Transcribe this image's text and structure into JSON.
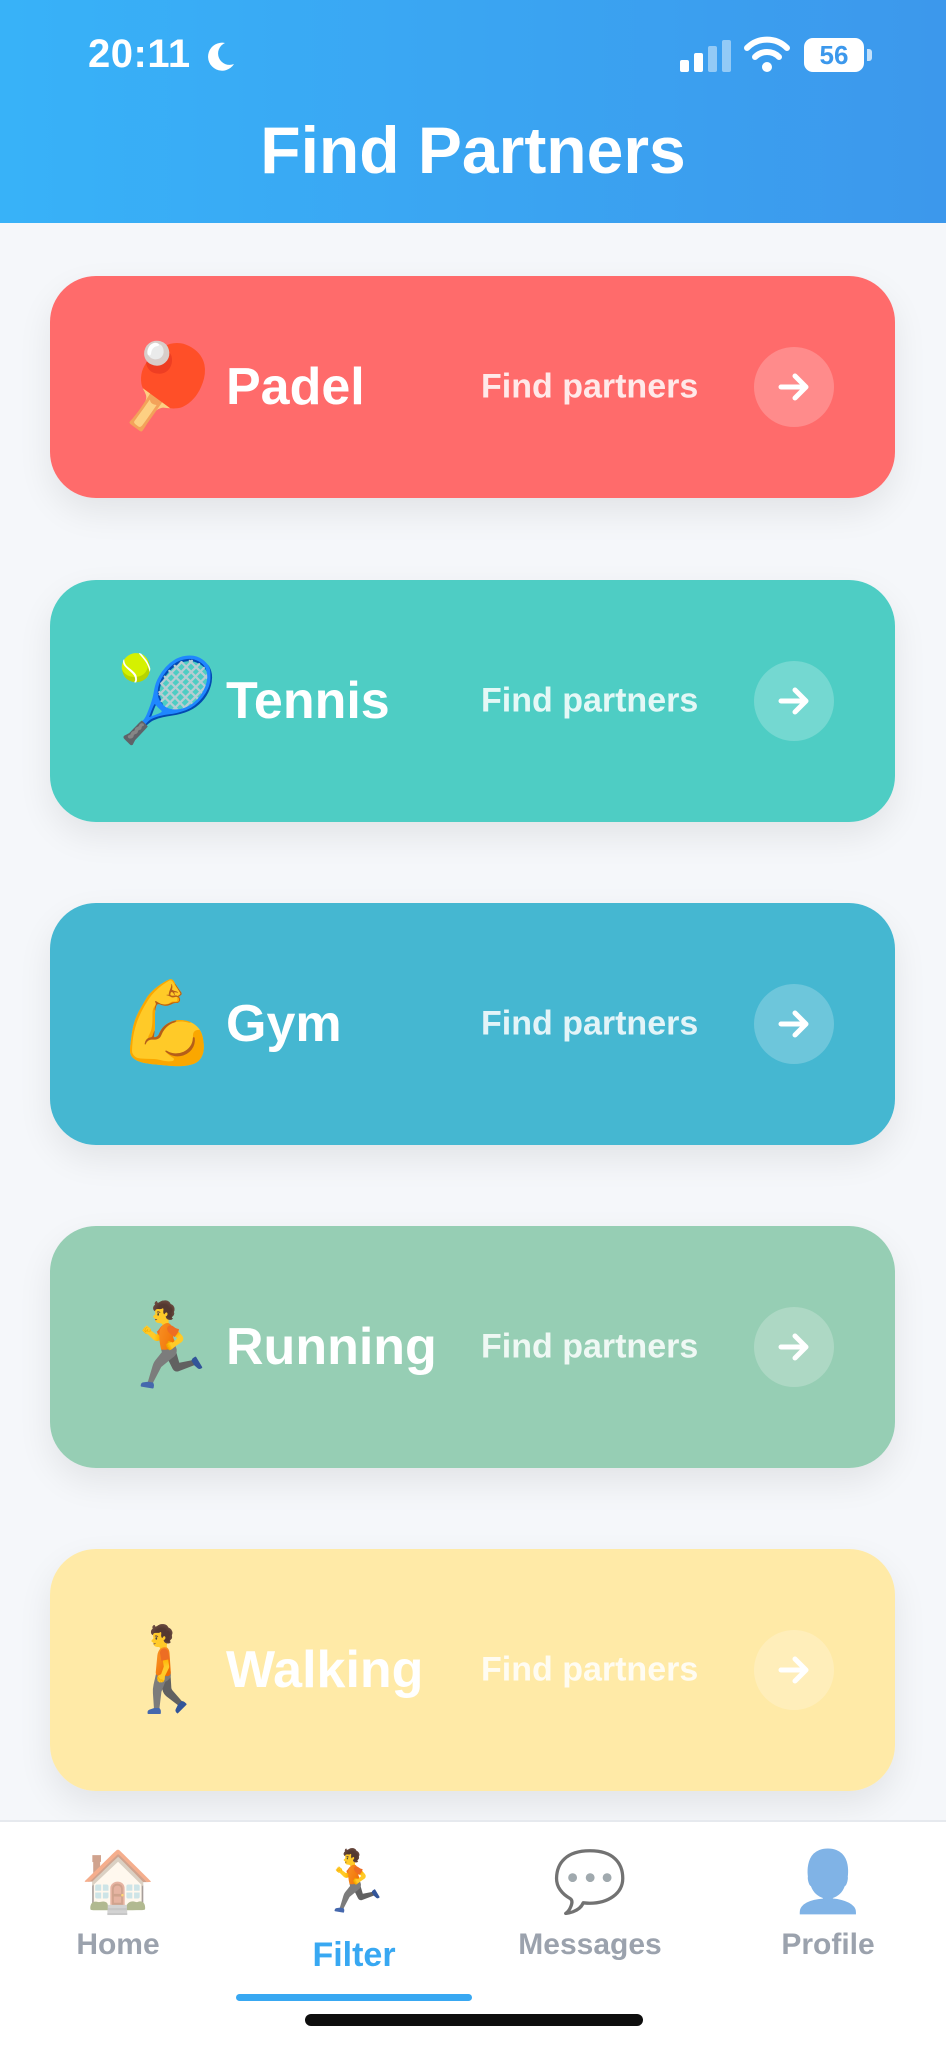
{
  "status_bar": {
    "time": "20:11",
    "battery": "56"
  },
  "header": {
    "title": "Find Partners"
  },
  "colors": {
    "header_start": "#38B2F8",
    "header_end": "#3C98EC",
    "active_tab": "#38A8F2"
  },
  "sports": [
    {
      "name": "Padel",
      "emoji": "🏓",
      "emoji_name": "padel-racket-icon",
      "cta": "Find partners",
      "color": "#FF6B6B"
    },
    {
      "name": "Tennis",
      "emoji": "🎾",
      "emoji_name": "tennis-ball-icon",
      "cta": "Find partners",
      "color": "#4ECDC4"
    },
    {
      "name": "Gym",
      "emoji": "💪",
      "emoji_name": "flexed-biceps-icon",
      "cta": "Find partners",
      "color": "#45B7D1"
    },
    {
      "name": "Running",
      "emoji": "🏃",
      "emoji_name": "runner-icon",
      "cta": "Find partners",
      "color": "#96CEB4"
    },
    {
      "name": "Walking",
      "emoji": "🚶",
      "emoji_name": "walker-icon",
      "cta": "Find partners",
      "color": "#FFEAA7"
    }
  ],
  "tabs": [
    {
      "label": "Home",
      "icon": "🏠",
      "icon_name": "house-icon",
      "active": false
    },
    {
      "label": "Filter",
      "icon": "🏃",
      "icon_name": "runner-icon",
      "active": true
    },
    {
      "label": "Messages",
      "icon": "💬",
      "icon_name": "speech-bubble-icon",
      "active": false
    },
    {
      "label": "Profile",
      "icon": "👤",
      "icon_name": "person-silhouette-icon",
      "active": false
    }
  ]
}
